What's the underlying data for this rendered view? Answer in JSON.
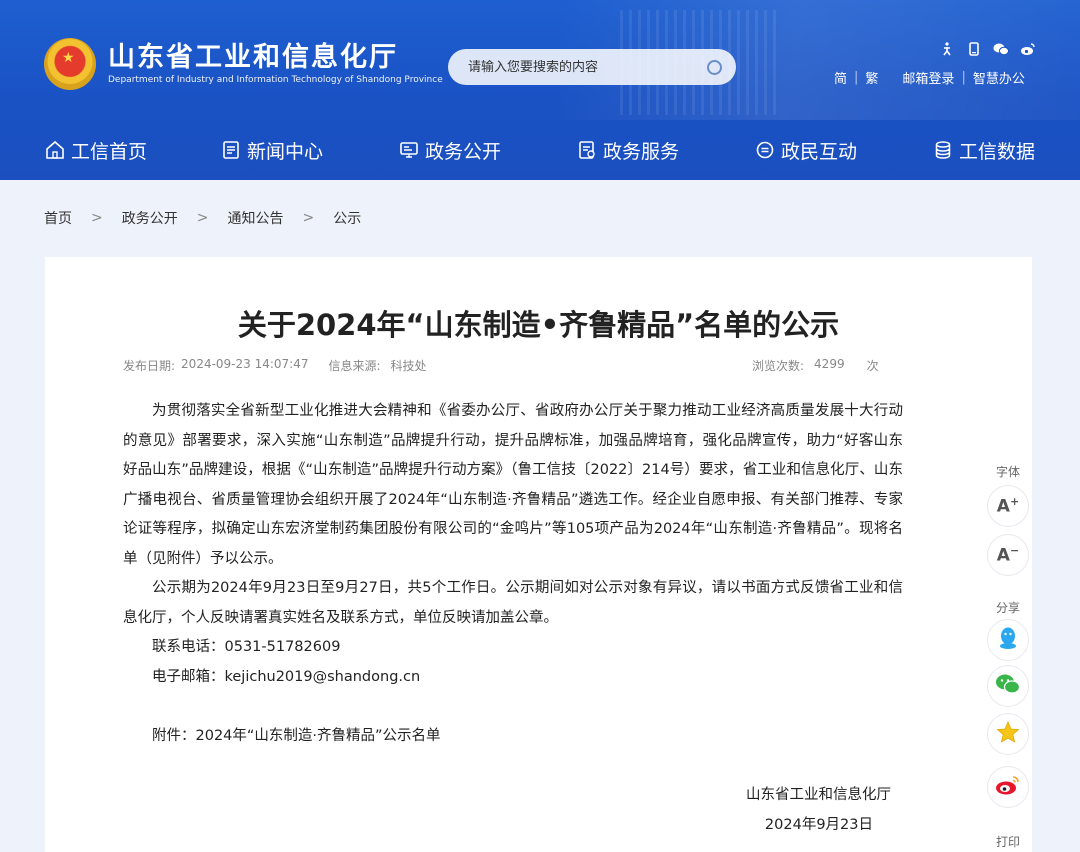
{
  "header": {
    "site_name_cn": "山东省工业和信息化厅",
    "site_name_en": "Department of Industry and Information Technology of Shandong Province",
    "search_placeholder": "请输入您要搜索的内容",
    "links": [
      "简",
      "繁",
      "邮箱登录",
      "智慧办公"
    ]
  },
  "nav": [
    {
      "label": "工信首页",
      "icon": "home-icon"
    },
    {
      "label": "新闻中心",
      "icon": "news-icon"
    },
    {
      "label": "政务公开",
      "icon": "screen-icon"
    },
    {
      "label": "政务服务",
      "icon": "service-icon"
    },
    {
      "label": "政民互动",
      "icon": "chat-icon"
    },
    {
      "label": "工信数据",
      "icon": "database-icon"
    }
  ],
  "breadcrumb": [
    "首页",
    "政务公开",
    "通知公告",
    "公示"
  ],
  "article": {
    "title": "关于2024年“山东制造•齐鲁精品”名单的公示",
    "publish_label": "发布日期:",
    "publish_date": "2024-09-23 14:07:47",
    "source_label": "信息来源:",
    "source": "科技处",
    "views_label": "浏览次数:",
    "views": "4299",
    "views_unit": "次",
    "paragraphs": [
      "为贯彻落实全省新型工业化推进大会精神和《省委办公厅、省政府办公厅关于聚力推动工业经济高质量发展十大行动的意见》部署要求，深入实施“山东制造”品牌提升行动，提升品牌标准，加强品牌培育，强化品牌宣传，助力“好客山东 好品山东”品牌建设，根据《“山东制造”品牌提升行动方案》（鲁工信技〔2022〕214号）要求，省工业和信息化厅、山东广播电视台、省质量管理协会组织开展了2024年“山东制造·齐鲁精品”遴选工作。经企业自愿申报、有关部门推荐、专家论证等程序，拟确定山东宏济堂制药集团股份有限公司的“金鸣片”等105项产品为2024年“山东制造·齐鲁精品”。现将名单（见附件）予以公示。",
      "公示期为2024年9月23日至9月27日，共5个工作日。公示期间如对公示对象有异议，请以书面方式反馈省工业和信息化厅，个人反映请署真实姓名及联系方式，单位反映请加盖公章。",
      "联系电话：0531-51782609",
      "电子邮箱：kejichu2019@shandong.cn"
    ],
    "attachment": "附件：2024年“山东制造·齐鲁精品”公示名单",
    "signature_org": "山东省工业和信息化厅",
    "signature_date": "2024年9月23日"
  },
  "side_tools": {
    "font_label": "字体",
    "font_increase": "A",
    "font_decrease": "A",
    "share_label": "分享",
    "print_label": "打印"
  }
}
